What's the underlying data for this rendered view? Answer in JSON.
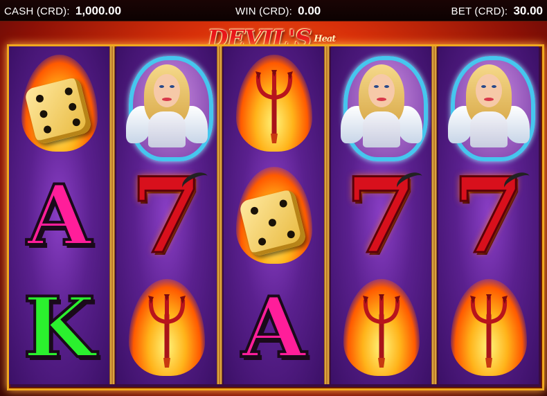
{
  "status_bar": {
    "cash": {
      "label": "CASH (CRD):",
      "value": "1,000.00"
    },
    "win": {
      "label": "WIN (CRD):",
      "value": "0.00"
    },
    "bet": {
      "label": "BET (CRD):",
      "value": "30.00"
    }
  },
  "logo": {
    "text": "DEVIL'S",
    "tag": "Heat"
  },
  "colors": {
    "frame_gold": "#f0a81e",
    "reel_purple": "#5a208e",
    "letter_A": "#ff1e9a",
    "letter_K": "#2bf02e",
    "seven_red": "#d8101c"
  },
  "reels": [
    {
      "symbols": [
        "dice",
        "A",
        "K"
      ]
    },
    {
      "symbols": [
        "angel",
        "seven",
        "trident"
      ]
    },
    {
      "symbols": [
        "trident",
        "dice",
        "A"
      ]
    },
    {
      "symbols": [
        "angel",
        "seven",
        "trident"
      ]
    },
    {
      "symbols": [
        "angel",
        "seven",
        "trident"
      ]
    }
  ],
  "letters": {
    "A": "A",
    "K": "K",
    "seven": "7"
  }
}
